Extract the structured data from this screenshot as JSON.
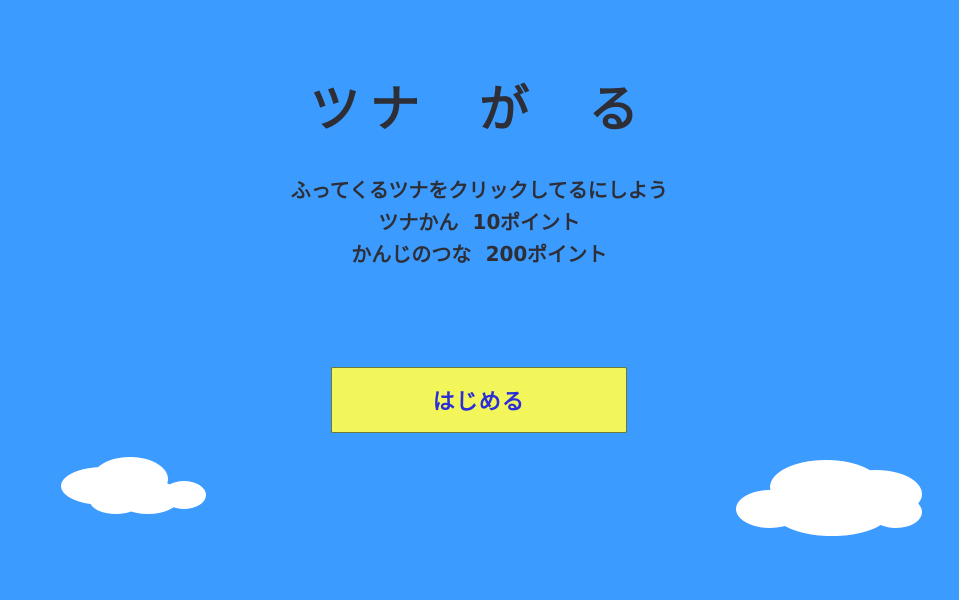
{
  "game": {
    "title": "ツナ が る",
    "instructions": {
      "line1": "ふってくるツナをクリックしてるにしよう",
      "line2": "ツナかん  10ポイント",
      "line3": "かんじのつな  200ポイント"
    },
    "start_button_label": "はじめる"
  },
  "colors": {
    "sky": "#3b9bff",
    "text": "#2e2e36",
    "button_bg": "#f2f65a",
    "button_text": "#2a2dd8",
    "cloud": "#ffffff"
  },
  "icons": [
    "cloud-left",
    "cloud-right"
  ]
}
